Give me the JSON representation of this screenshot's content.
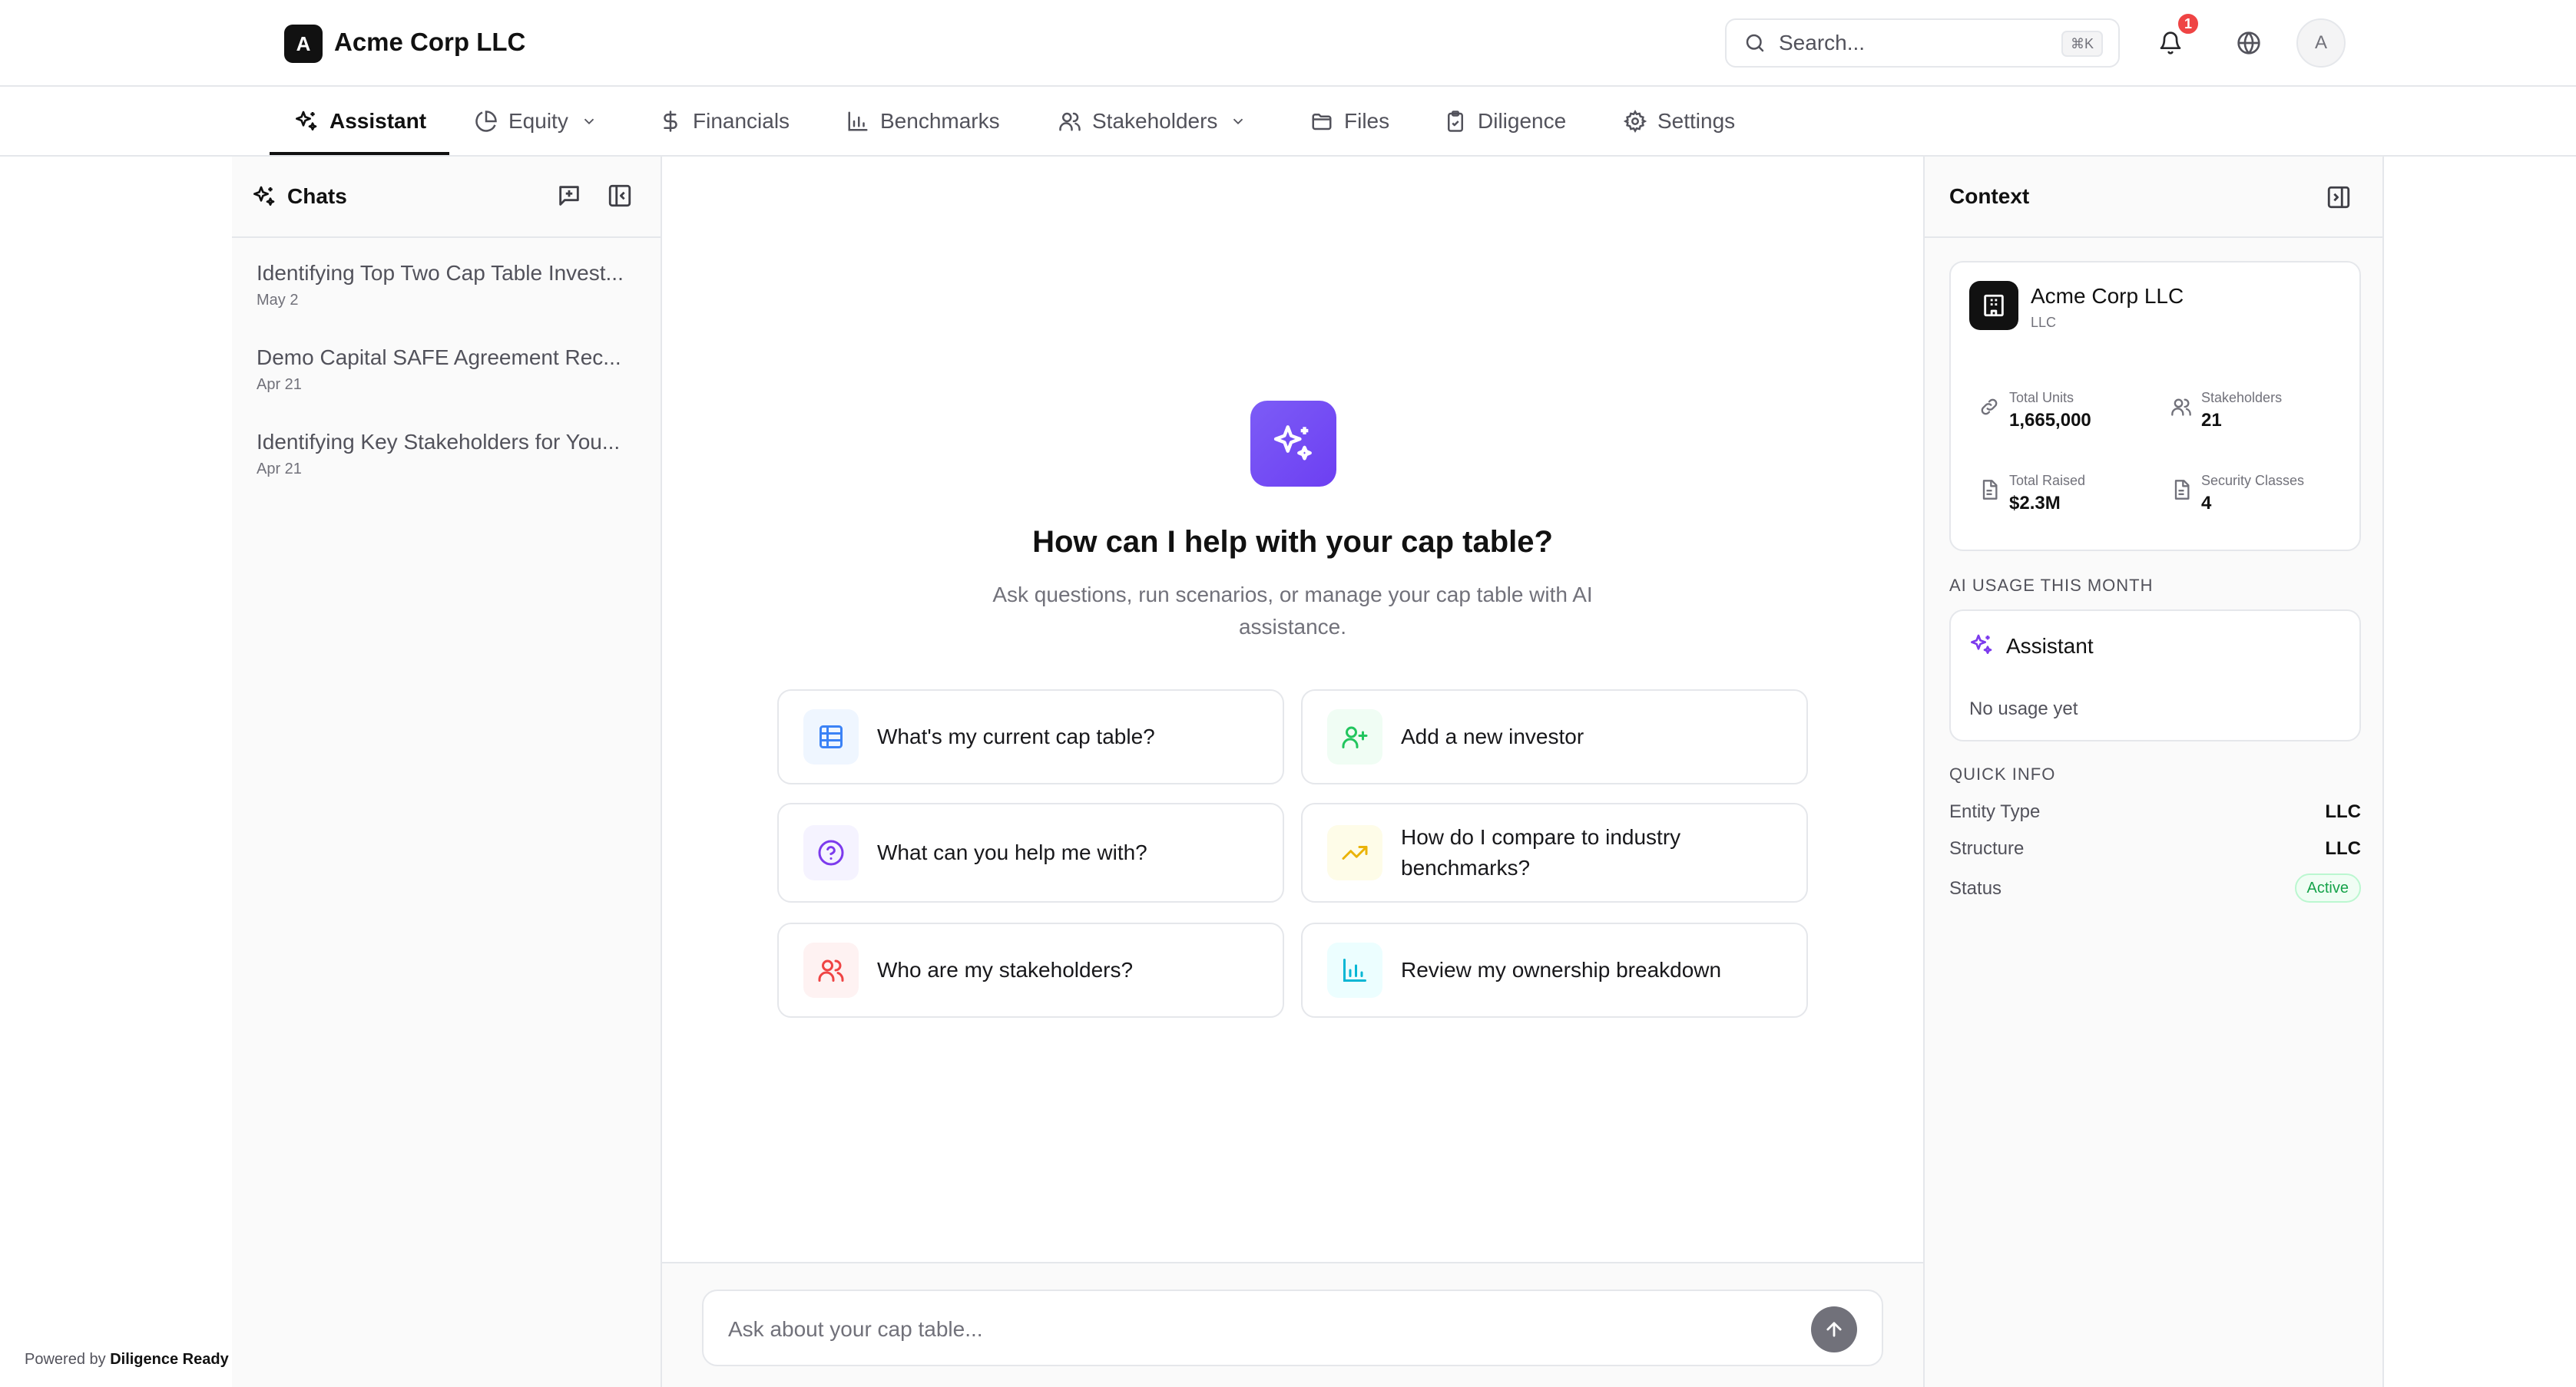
{
  "header": {
    "logo_letter": "A",
    "company_name": "Acme Corp LLC",
    "search_placeholder": "Search...",
    "search_shortcut": "⌘K",
    "notification_count": "1",
    "avatar_letter": "A"
  },
  "nav": {
    "tabs": [
      {
        "label": "Assistant",
        "icon": "sparkles-icon",
        "active": true
      },
      {
        "label": "Equity",
        "icon": "pie-chart-icon",
        "dropdown": true
      },
      {
        "label": "Financials",
        "icon": "dollar-icon"
      },
      {
        "label": "Benchmarks",
        "icon": "bar-chart-icon"
      },
      {
        "label": "Stakeholders",
        "icon": "users-icon",
        "dropdown": true
      },
      {
        "label": "Files",
        "icon": "folder-icon"
      },
      {
        "label": "Diligence",
        "icon": "clipboard-check-icon"
      },
      {
        "label": "Settings",
        "icon": "gear-icon"
      }
    ]
  },
  "sidebar": {
    "title": "Chats",
    "chats": [
      {
        "title": "Identifying Top Two Cap Table Invest...",
        "date": "May 2"
      },
      {
        "title": "Demo Capital SAFE Agreement Rec...",
        "date": "Apr 21"
      },
      {
        "title": "Identifying Key Stakeholders for You...",
        "date": "Apr 21"
      }
    ],
    "powered_prefix": "Powered by",
    "powered_brand": "Diligence Ready"
  },
  "main": {
    "title": "How can I help with your cap table?",
    "subtitle": "Ask questions, run scenarios, or manage your cap table with AI assistance.",
    "suggestions": [
      {
        "label": "What's my current cap table?",
        "icon": "table-icon",
        "color": "#3b82f6"
      },
      {
        "label": "Add a new investor",
        "icon": "user-plus-icon",
        "color": "#22c55e"
      },
      {
        "label": "What can you help me with?",
        "icon": "help-circle-icon",
        "color": "#7c3aed"
      },
      {
        "label": "How do I compare to industry benchmarks?",
        "icon": "trending-up-icon",
        "color": "#eab308"
      },
      {
        "label": "Who are my stakeholders?",
        "icon": "users-icon",
        "color": "#ef4444"
      },
      {
        "label": "Review my ownership breakdown",
        "icon": "bar-chart-icon",
        "color": "#06b6d4"
      }
    ],
    "composer_placeholder": "Ask about your cap table..."
  },
  "context": {
    "title": "Context",
    "entity": {
      "name": "Acme Corp LLC",
      "type": "LLC"
    },
    "stats": [
      {
        "label": "Total Units",
        "value": "1,665,000",
        "icon": "link-icon"
      },
      {
        "label": "Stakeholders",
        "value": "21",
        "icon": "users-icon"
      },
      {
        "label": "Total Raised",
        "value": "$2.3M",
        "icon": "document-icon"
      },
      {
        "label": "Security Classes",
        "value": "4",
        "icon": "document-icon"
      }
    ],
    "ai_usage_label": "AI USAGE THIS MONTH",
    "ai_usage": {
      "name": "Assistant",
      "status": "No usage yet"
    },
    "quick_info_label": "QUICK INFO",
    "quick_info": [
      {
        "key": "Entity Type",
        "value": "LLC"
      },
      {
        "key": "Structure",
        "value": "LLC"
      },
      {
        "key": "Status",
        "value": "Active"
      }
    ]
  },
  "colors": {
    "accent": "#6d3ff2",
    "active_green": "#16a34a"
  }
}
